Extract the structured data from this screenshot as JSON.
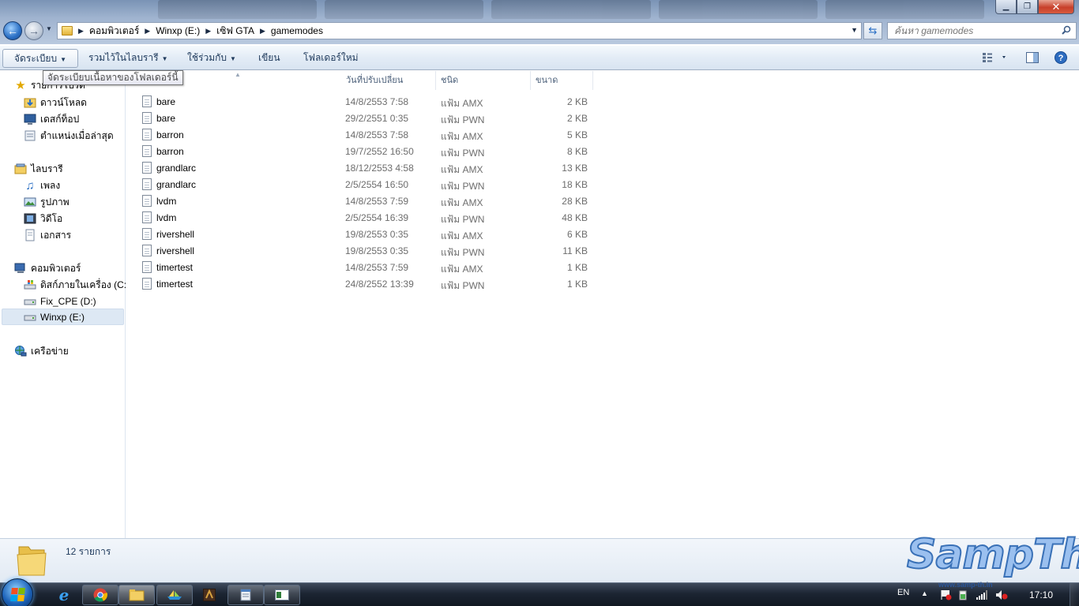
{
  "window": {
    "min_label": "▁",
    "max_label": "❐",
    "close_label": "✕"
  },
  "address": {
    "crumbs": [
      "คอมพิวเตอร์",
      "Winxp (E:)",
      "เซิฟ GTA",
      "gamemodes"
    ]
  },
  "search": {
    "placeholder": "ค้นหา gamemodes"
  },
  "toolbar": {
    "organize": "จัดระเบียบ",
    "include_library": "รวมไว้ในไลบรารี",
    "share_with": "ใช้ร่วมกับ",
    "burn": "เขียน",
    "new_folder": "โฟลเดอร์ใหม่"
  },
  "tooltip": "จัดระเบียบเนื้อหาของโฟลเดอร์นี้",
  "navpane": {
    "favorites": "รายการโปรด",
    "downloads": "ดาวน์โหลด",
    "desktop": "เดสก์ท็อป",
    "recent": "ตำแหน่งเมื่อล่าสุด",
    "libraries": "ไลบรารี",
    "music": "เพลง",
    "pictures": "รูปภาพ",
    "videos": "วิดีโอ",
    "documents": "เอกสาร",
    "computer": "คอมพิวเตอร์",
    "drive_c": "ดิสก์ภายในเครื่อง (C:)",
    "drive_d": "Fix_CPE (D:)",
    "drive_e": "Winxp (E:)",
    "network": "เครือข่าย"
  },
  "columns": {
    "date": "วันที่ปรับเปลี่ยน",
    "type": "ชนิด",
    "size": "ขนาด"
  },
  "files": [
    {
      "name": "bare",
      "date": "14/8/2553 7:58",
      "type": "แฟ้ม AMX",
      "size": "2 KB"
    },
    {
      "name": "bare",
      "date": "29/2/2551 0:35",
      "type": "แฟ้ม PWN",
      "size": "2 KB"
    },
    {
      "name": "barron",
      "date": "14/8/2553 7:58",
      "type": "แฟ้ม AMX",
      "size": "5 KB"
    },
    {
      "name": "barron",
      "date": "19/7/2552 16:50",
      "type": "แฟ้ม PWN",
      "size": "8 KB"
    },
    {
      "name": "grandlarc",
      "date": "18/12/2553 4:58",
      "type": "แฟ้ม AMX",
      "size": "13 KB"
    },
    {
      "name": "grandlarc",
      "date": "2/5/2554 16:50",
      "type": "แฟ้ม PWN",
      "size": "18 KB"
    },
    {
      "name": "lvdm",
      "date": "14/8/2553 7:59",
      "type": "แฟ้ม AMX",
      "size": "28 KB"
    },
    {
      "name": "lvdm",
      "date": "2/5/2554 16:39",
      "type": "แฟ้ม PWN",
      "size": "48 KB"
    },
    {
      "name": "rivershell",
      "date": "19/8/2553 0:35",
      "type": "แฟ้ม AMX",
      "size": "6 KB"
    },
    {
      "name": "rivershell",
      "date": "19/8/2553 0:35",
      "type": "แฟ้ม PWN",
      "size": "11 KB"
    },
    {
      "name": "timertest",
      "date": "14/8/2553 7:59",
      "type": "แฟ้ม AMX",
      "size": "1 KB"
    },
    {
      "name": "timertest",
      "date": "24/8/2552 13:39",
      "type": "แฟ้ม PWN",
      "size": "1 KB"
    }
  ],
  "details": {
    "item_count": "12 รายการ"
  },
  "watermark": {
    "brand": "SampTh",
    "url": "www.samp-th.in"
  },
  "taskbar": {
    "lang": "EN",
    "clock": "17:10"
  },
  "colors": {
    "accent": "#1e395b",
    "selection": "#dde8f4",
    "taskbar": "#1c2533"
  }
}
